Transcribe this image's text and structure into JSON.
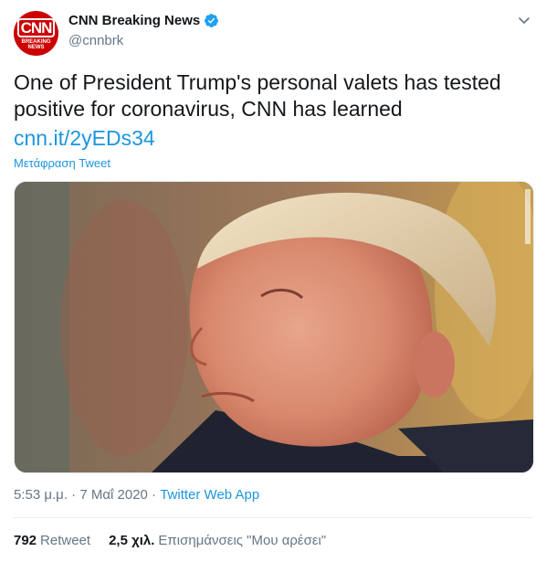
{
  "account": {
    "name": "CNN Breaking News",
    "handle": "@cnnbrk",
    "avatar_logo_text": "CNN",
    "avatar_sub_text": "BREAKING NEWS",
    "verified": true
  },
  "tweet": {
    "text": "One of President Trump's personal valets has tested positive for coronavirus, CNN has learned",
    "link": "cnn.it/2yEDs34",
    "translate_label": "Μετάφραση Tweet"
  },
  "meta": {
    "time": "5:53 μ.μ.",
    "separator": "·",
    "date": "7 Μαΐ 2020",
    "source": "Twitter Web App"
  },
  "stats": {
    "retweets_count": "792",
    "retweets_label": "Retweet",
    "likes_count": "2,5 χιλ.",
    "likes_label": "Επισημάνσεις \"Μου αρέσει\""
  },
  "colors": {
    "brand": "#cc0000",
    "link": "#1b95e0",
    "muted": "#657786",
    "text": "#14171a"
  },
  "icons": [
    "verified-badge-icon",
    "chevron-down-icon"
  ]
}
